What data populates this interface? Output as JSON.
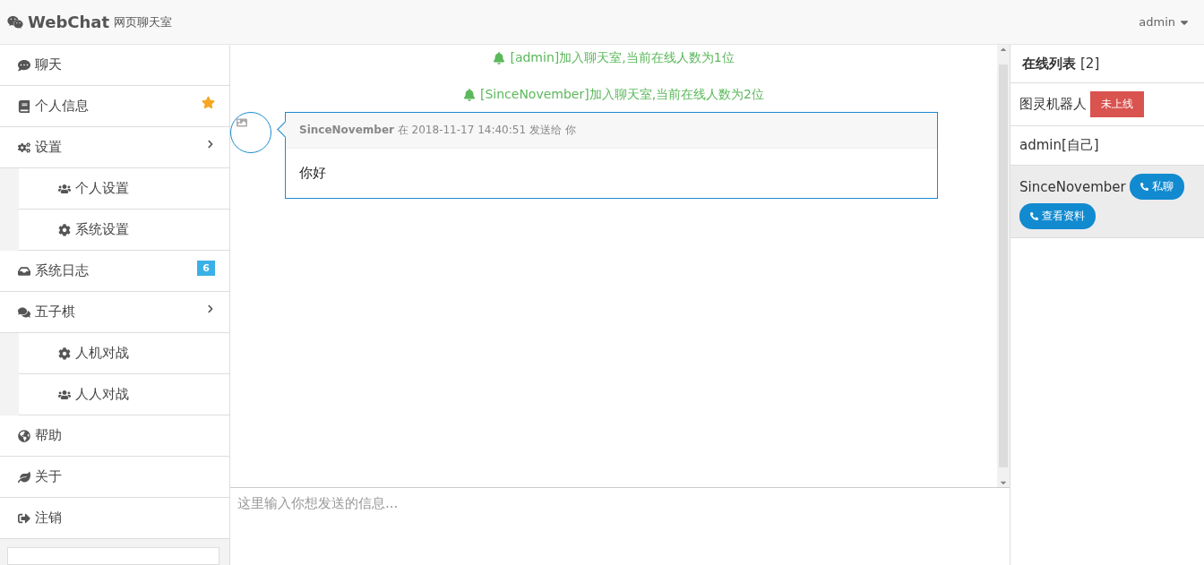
{
  "header": {
    "brand": "WebChat",
    "subtitle": "网页聊天室",
    "user": "admin"
  },
  "sidebar": {
    "items": [
      {
        "label": "聊天"
      },
      {
        "label": "个人信息",
        "badge": {
          "kind": "star"
        }
      },
      {
        "label": "设置",
        "expanded": true,
        "children": [
          {
            "label": "个人设置"
          },
          {
            "label": "系统设置"
          }
        ]
      },
      {
        "label": "系统日志",
        "badge": {
          "kind": "count",
          "text": "6"
        }
      },
      {
        "label": "五子棋",
        "expanded": true,
        "children": [
          {
            "label": "人机对战"
          },
          {
            "label": "人人对战"
          }
        ]
      },
      {
        "label": "帮助"
      },
      {
        "label": "关于"
      },
      {
        "label": "注销"
      }
    ]
  },
  "chat": {
    "notices": [
      "[admin]加入聊天室,当前在线人数为1位",
      "[SinceNovember]加入聊天室,当前在线人数为2位"
    ],
    "messages": [
      {
        "sender": "SinceNovember",
        "meta": "在 2018-11-17 14:40:51 发送给 你",
        "body": "你好"
      }
    ],
    "input": {
      "placeholder": "这里输入你想发送的信息..."
    }
  },
  "online": {
    "title": "在线列表",
    "count": "[2]",
    "users": [
      {
        "name": "图灵机器人",
        "status": "未上线",
        "selected": false
      },
      {
        "name": "admin[自己]",
        "selected": false
      },
      {
        "name": "SinceNovember",
        "selected": true,
        "actions": [
          "私聊",
          "查看资料"
        ]
      }
    ]
  }
}
